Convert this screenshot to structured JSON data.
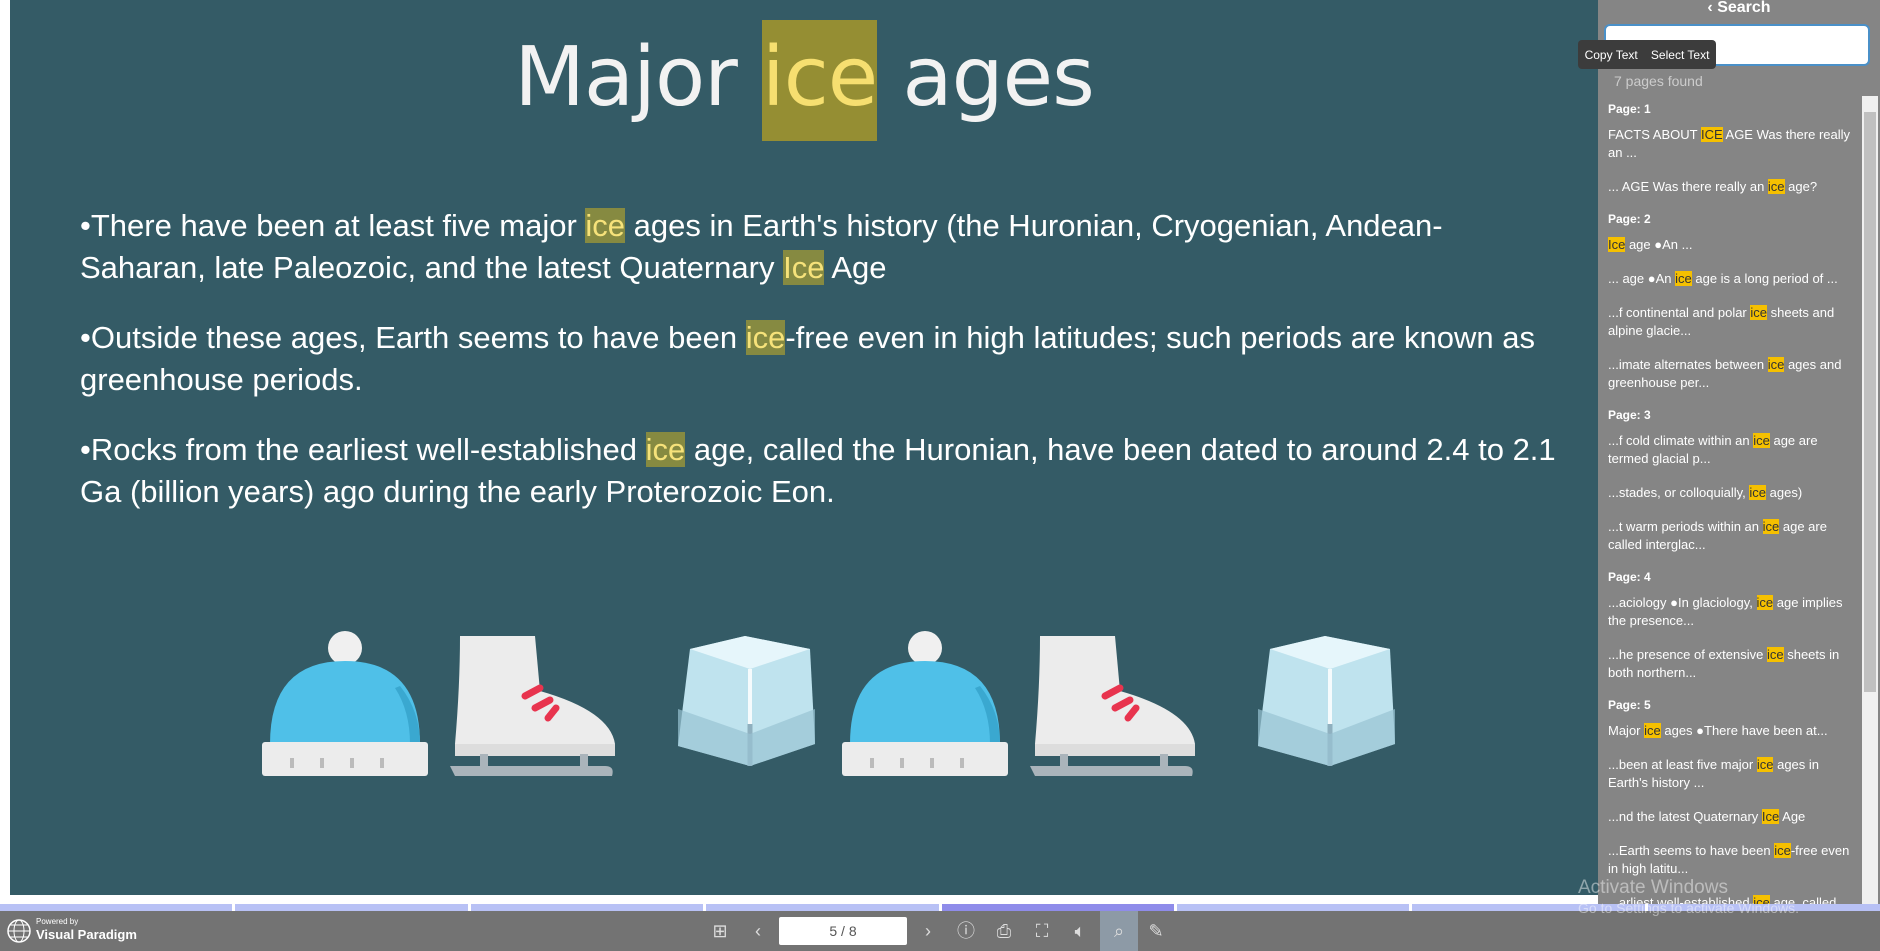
{
  "slide": {
    "title": {
      "before": "Major ",
      "highlight": "ice",
      "after": " ages"
    },
    "bullets": [
      [
        "•There have been at least five major ",
        "ice",
        " ages in Earth's history (the Huronian, Cryogenian, Andean-Saharan, late Paleozoic, and the latest Quaternary ",
        "Ice",
        " Age"
      ],
      [
        "•Outside these ages, Earth seems to have been ",
        "ice",
        "-free even in high latitudes; such periods are known as greenhouse periods.",
        "",
        ""
      ],
      [
        "•Rocks from the earliest well-established ",
        "ice",
        " age, called the Huronian, have been dated to around 2.4 to 2.1 Ga (billion years) ago during the early Proterozoic Eon.",
        "",
        ""
      ]
    ],
    "icons": [
      "beanie-hat",
      "ice-skate",
      "ice-cube",
      "beanie-hat",
      "ice-skate",
      "ice-cube"
    ]
  },
  "sidebar": {
    "header": "Search",
    "search_value": "ice",
    "found": "7 pages found",
    "tooltip": {
      "copy": "Copy Text",
      "select": "Select Text"
    },
    "groups": [
      {
        "page": "Page: 1",
        "results": [
          [
            "FACTS ABOUT ",
            "ICE",
            " AGE Was there really an ..."
          ],
          [
            "... AGE Was there really an ",
            "ice",
            " age?"
          ]
        ]
      },
      {
        "page": "Page: 2",
        "results": [
          [
            "",
            "Ice",
            " age ●An ..."
          ],
          [
            "... age ●An ",
            "ice",
            " age is a long period of ..."
          ],
          [
            "...f continental and polar ",
            "ice",
            " sheets and alpine glacie..."
          ],
          [
            "...imate alternates between ",
            "ice",
            " ages and greenhouse per..."
          ]
        ]
      },
      {
        "page": "Page: 3",
        "results": [
          [
            "...f cold climate within an ",
            "ice",
            " age are termed glacial p..."
          ],
          [
            "...stades, or colloquially, ",
            "ice",
            " ages)"
          ],
          [
            "...t warm periods within an ",
            "ice",
            " age are called interglac..."
          ]
        ]
      },
      {
        "page": "Page: 4",
        "results": [
          [
            "...aciology ●In glaciology, ",
            "ice",
            " age implies the presence..."
          ],
          [
            "...he presence of extensive ",
            "ice",
            " sheets in both northern..."
          ]
        ]
      },
      {
        "page": "Page: 5",
        "results": [
          [
            "Major ",
            "ice",
            " ages ●There have been at..."
          ],
          [
            "...been at least five major ",
            "ice",
            " ages in Earth's history ..."
          ],
          [
            "...nd the latest Quaternary ",
            "Ice",
            " Age"
          ],
          [
            "...Earth seems to have been ",
            "ice",
            "-free even in high latitu..."
          ],
          [
            "...arliest well-established ",
            "ice",
            " age, called ..."
          ]
        ]
      }
    ]
  },
  "toolbar": {
    "brand_small": "Powered by",
    "brand": "Visual Paradigm",
    "page": "5 / 8",
    "current_page": 5,
    "total_pages": 8
  },
  "watermark": {
    "line1": "Activate Windows",
    "line2": "Go to Settings to activate Windows."
  },
  "colors": {
    "slide_bg": "#345b66",
    "highlight": "#f5c000",
    "sidebar_bg": "#858585",
    "toolbar_bg": "#737373"
  }
}
